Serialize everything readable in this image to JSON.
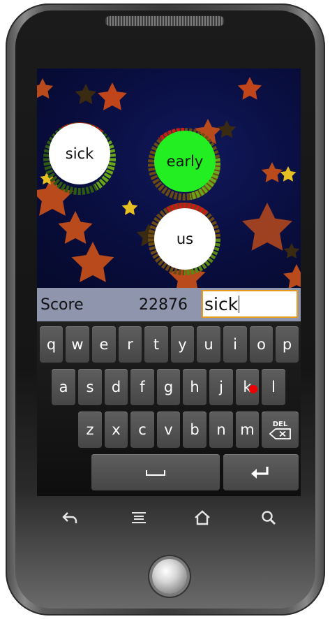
{
  "game": {
    "bubbles": [
      {
        "word": "sick",
        "color": "#ffffff"
      },
      {
        "word": "early",
        "color": "#22ee22"
      },
      {
        "word": "us",
        "color": "#ffffff"
      }
    ]
  },
  "scorebar": {
    "label": "Score",
    "value": "22876",
    "input_value": "sick"
  },
  "keyboard": {
    "row1": [
      "q",
      "w",
      "e",
      "r",
      "t",
      "y",
      "u",
      "i",
      "o",
      "p"
    ],
    "row2": [
      "a",
      "s",
      "d",
      "f",
      "g",
      "h",
      "j",
      "k",
      "l"
    ],
    "row3": [
      "z",
      "x",
      "c",
      "v",
      "b",
      "n",
      "m"
    ],
    "del_label": "DEL",
    "space_symbol": "⎵",
    "enter_symbol": "↵"
  },
  "navbar": {
    "back_icon": "back-icon",
    "menu_icon": "menu-icon",
    "home_icon": "home-icon",
    "search_icon": "search-icon"
  },
  "colors": {
    "score_bar": "#8f95ad",
    "input_border": "#e89a1a",
    "touch_indicator": "#ee0000"
  }
}
